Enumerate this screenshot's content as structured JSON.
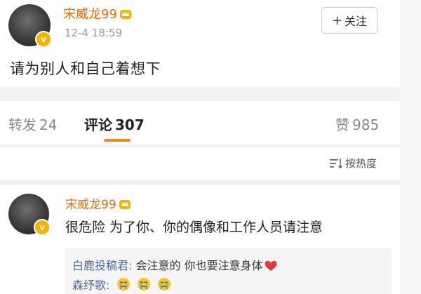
{
  "post": {
    "username": "宋威龙99",
    "crown_icon": "crown-icon",
    "badge_icon": "verified-badge-icon",
    "timestamp": "12-4 18:59",
    "follow_label": "关注",
    "follow_plus": "+",
    "text": "请为别人和自己着想下"
  },
  "stats": {
    "repost_label": "转发",
    "repost_count": "24",
    "comment_label": "评论",
    "comment_count": "307",
    "like_label": "赞",
    "like_count": "985"
  },
  "sort": {
    "label": "按热度",
    "icon": "sort-icon"
  },
  "comment": {
    "username": "宋威龙99",
    "text": "很危险 为了你、你的偶像和工作人员请注意",
    "replies": [
      {
        "name": "白鹿投稿君:",
        "text": "会注意的 你也要注意身体",
        "icon": "heart-icon"
      },
      {
        "name": "森纾歌:",
        "text": "",
        "icon": "crying-emoji-icon"
      }
    ]
  },
  "colors": {
    "username": "#e86b0c",
    "accent_underline": "#f08a1c",
    "reply_name": "#4d6d99",
    "heart": "#e0393e",
    "badge": "#f4b300"
  }
}
